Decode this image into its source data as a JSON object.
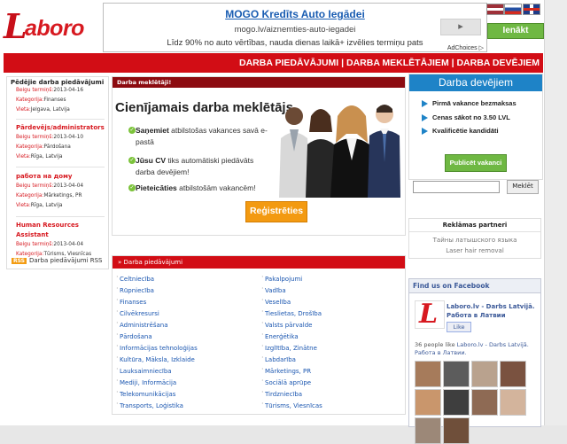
{
  "site": {
    "logo_text": "Laboro",
    "logo_initial": "L",
    "logo_rest": "aboro"
  },
  "ad": {
    "title": "MOGO Kredīts Auto Iegādei",
    "url": "mogo.lv/aiznemties-auto-iegadei",
    "description": "Līdz 90% no auto vērtības, nauda dienas laikā+ izvēlies termiņu pats",
    "arrow": "▸",
    "adchoices": "AdChoices ▷"
  },
  "header": {
    "enter_label": "Ienākt",
    "languages": [
      "lv",
      "ru",
      "en"
    ]
  },
  "nav": {
    "links_text": "DARBA PIEDĀVĀJUMI | DARBA MEKLĒTĀJIEM | DARBA DEVĒJIEM"
  },
  "latest_jobs": {
    "title": "Pēdējie darba piedāvājumi",
    "items": [
      {
        "title": "",
        "deadline_label": "Beigu termiņš:",
        "deadline": "2013-04-16",
        "category_label": "Kategorija:",
        "category": "Finanses",
        "location_label": "Vieta:",
        "location": "Jelgava, Latvija"
      },
      {
        "title": "Pārdevējs/administrators",
        "deadline_label": "Beigu termiņš:",
        "deadline": "2013-04-10",
        "category_label": "Kategorija:",
        "category": "Pārdošana",
        "location_label": "Vieta:",
        "location": "Rīga, Latvija"
      },
      {
        "title": "работа на дому",
        "deadline_label": "Beigu termiņš:",
        "deadline": "2013-04-04",
        "category_label": "Kategorija:",
        "category": "Mārketings, PR",
        "location_label": "Vieta:",
        "location": "Rīga, Latvija"
      },
      {
        "title": "Human Resources Assistant",
        "deadline_label": "Beigu termiņš:",
        "deadline": "2013-04-04",
        "category_label": "Kategorija:",
        "category": "Tūrisms, Viesnīcas",
        "location_label": "",
        "location": ""
      }
    ],
    "rss_badge": "RSS",
    "rss_label": "Darba piedāvājumi RSS"
  },
  "seekers": {
    "header": "Darba meklētāji!",
    "title": "Cienījamais darba meklētājs",
    "bullets": [
      {
        "bold": "Saņemiet",
        "text": " atbilstošas vakances savā e-pastā"
      },
      {
        "bold": "Jūsu CV",
        "text": " tiks automātiski piedāvāts darba devējiem!"
      },
      {
        "bold": "Pieteicāties",
        "text": " atbilstošām vakancēm!"
      }
    ],
    "check_glyph": "✓",
    "register_label": "Reģistrēties"
  },
  "employers": {
    "header": "Darba devējiem",
    "items": [
      "Pirmā vakance bezmaksas",
      "Cenas sākot no 3.50 LVL",
      "Kvalificētie kandidāti"
    ],
    "post_label": "Publicēt vakanci",
    "search_button": "Meklēt"
  },
  "partners": {
    "title": "Reklāmas partneri",
    "links": [
      "Тайны латышского языка",
      "Laser hair removal"
    ]
  },
  "facebook": {
    "title": "Find us on Facebook",
    "page_name": "Laboro.lv - Darbs Latvijā. Работа в Латвии",
    "like_label": "Like",
    "like_prefix": "36 people like ",
    "like_link": "Laboro.lv - Darbs Latvijā. Работа в Латвии.",
    "logo_initial": "L"
  },
  "categories": {
    "title": "» Darba piedāvājumi",
    "left": [
      "Celtniecība",
      "Rūpniecība",
      "Finanses",
      "Cilvēkresursi",
      "Administrēšana",
      "Pārdošana",
      "Informācijas tehnoloģijas",
      "Kultūra, Māksla, Izklaide",
      "Lauksaimniecība",
      "Mediji, Informācija",
      "Telekomunikācijas",
      "Transports, Loģistika"
    ],
    "right": [
      "Pakalpojumi",
      "Vadība",
      "Veselība",
      "Tieslietas, Drošība",
      "Valsts pārvalde",
      "Enerģētika",
      "Izglītība, Zinātne",
      "Labdarība",
      "Mārketings, PR",
      "Sociālā aprūpe",
      "Tirdzniecība",
      "Tūrisms, Viesnīcas"
    ]
  },
  "colors": {
    "brand_red": "#d20d15",
    "dark_red": "#8c0b10",
    "blue": "#1e83c7",
    "green": "#6fb843",
    "orange": "#f39a11"
  }
}
